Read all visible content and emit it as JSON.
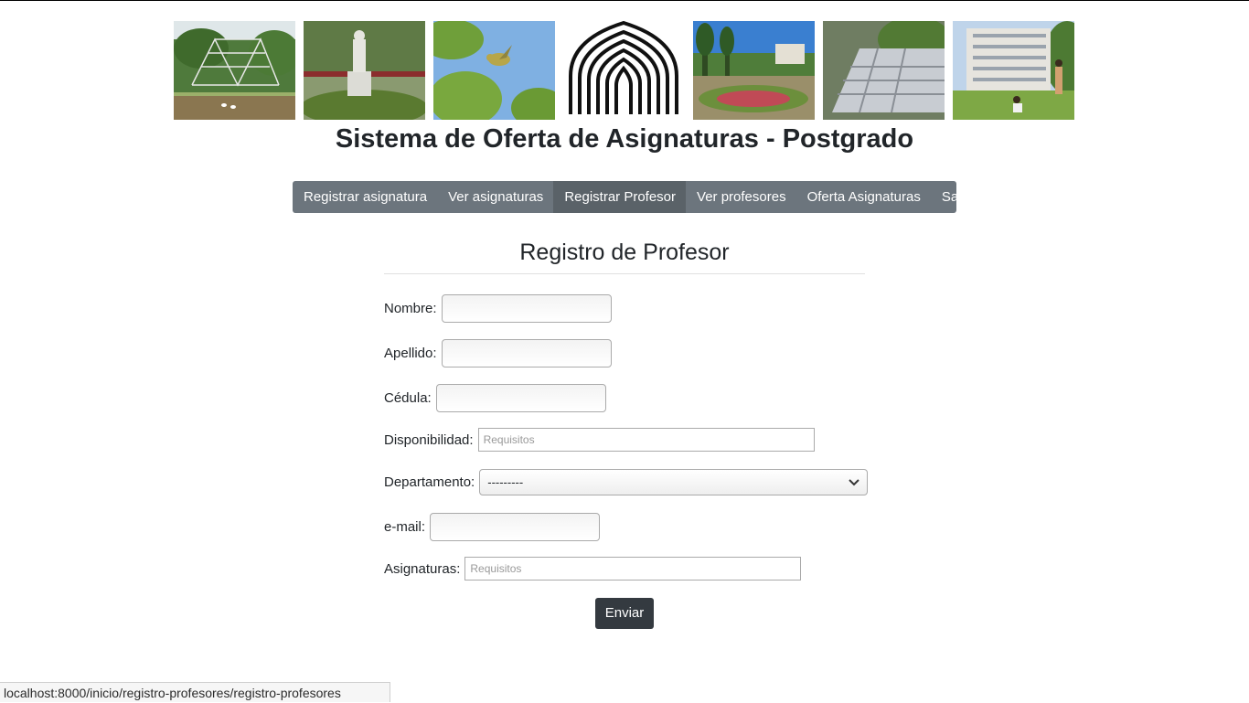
{
  "header": {
    "title": "Sistema de Oferta de Asignaturas - Postgrado",
    "photos": [
      {
        "name": "photo-sculpture-pond"
      },
      {
        "name": "photo-statue"
      },
      {
        "name": "photo-bird"
      },
      {
        "name": "logo-ucv"
      },
      {
        "name": "photo-campus-garden"
      },
      {
        "name": "photo-fountain"
      },
      {
        "name": "photo-building-lawn"
      }
    ]
  },
  "nav": {
    "items": [
      {
        "label": "Registrar asignatura",
        "active": false
      },
      {
        "label": "Ver asignaturas",
        "active": false
      },
      {
        "label": "Registrar Profesor",
        "active": true
      },
      {
        "label": "Ver profesores",
        "active": false
      },
      {
        "label": "Oferta Asignaturas",
        "active": false
      },
      {
        "label": "Salir",
        "active": false
      }
    ]
  },
  "form": {
    "title": "Registro de Profesor",
    "fields": {
      "nombre": {
        "label": "Nombre:",
        "value": ""
      },
      "apellido": {
        "label": "Apellido:",
        "value": ""
      },
      "cedula": {
        "label": "Cédula:",
        "value": ""
      },
      "disponibilidad": {
        "label": "Disponibilidad:",
        "placeholder": "Requisitos"
      },
      "departamento": {
        "label": "Departamento:",
        "selected": "---------"
      },
      "email": {
        "label": "e-mail:",
        "value": ""
      },
      "asignaturas": {
        "label": "Asignaturas:",
        "placeholder": "Requisitos"
      }
    },
    "submit_label": "Enviar"
  },
  "statusbar": {
    "url": "localhost:8000/inicio/registro-profesores/registro-profesores"
  }
}
